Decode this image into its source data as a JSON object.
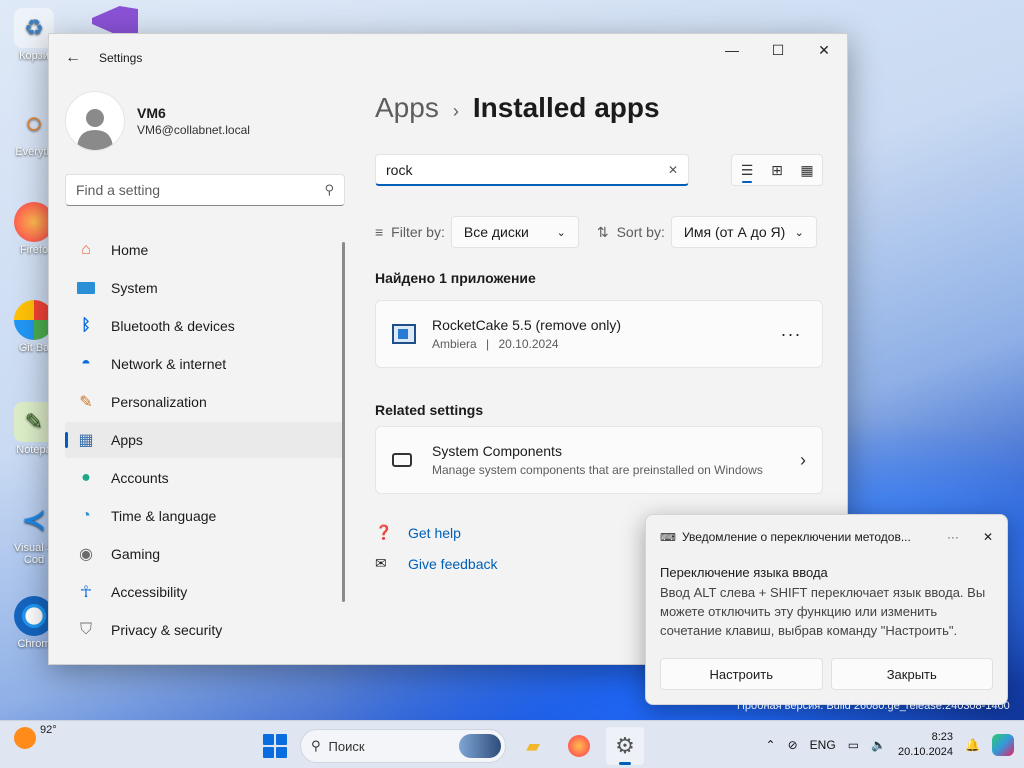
{
  "desktop": {
    "icons": [
      {
        "label": "Корзи",
        "icon": "recycle-bin-icon",
        "color": "#e8eef5"
      },
      {
        "label": "Everyth",
        "icon": "search-magnifier-icon",
        "color": "#f07a1a"
      },
      {
        "label": "Firefo",
        "icon": "firefox-icon",
        "color": "#ff7139"
      },
      {
        "label": "Git Ba",
        "icon": "git-bash-icon",
        "color": "#e8e8e8"
      },
      {
        "label": "Notepa",
        "icon": "notepad-icon",
        "color": "#7cb342"
      },
      {
        "label": "Visual S Cod",
        "icon": "vscode-icon",
        "color": "#1e88e5"
      },
      {
        "label": "Chrom",
        "icon": "chrome-icon",
        "color": "#2196f3"
      }
    ],
    "watermark": "Пробная версия. Build 26080.ge_release.240308-1400"
  },
  "window": {
    "title": "Settings",
    "controls": {
      "minimize": "—",
      "maximize": "☐",
      "close": "✕"
    }
  },
  "profile": {
    "name": "VM6",
    "email": "VM6@collabnet.local"
  },
  "sidebar": {
    "search_placeholder": "Find a setting",
    "items": [
      {
        "label": "Home",
        "icon": "home-icon"
      },
      {
        "label": "System",
        "icon": "system-icon"
      },
      {
        "label": "Bluetooth & devices",
        "icon": "bluetooth-icon"
      },
      {
        "label": "Network & internet",
        "icon": "wifi-icon"
      },
      {
        "label": "Personalization",
        "icon": "brush-icon"
      },
      {
        "label": "Apps",
        "icon": "apps-icon",
        "active": true
      },
      {
        "label": "Accounts",
        "icon": "accounts-icon"
      },
      {
        "label": "Time & language",
        "icon": "globe-clock-icon"
      },
      {
        "label": "Gaming",
        "icon": "gamepad-icon"
      },
      {
        "label": "Accessibility",
        "icon": "accessibility-icon"
      },
      {
        "label": "Privacy & security",
        "icon": "shield-icon"
      }
    ]
  },
  "main": {
    "breadcrumb_parent": "Apps",
    "breadcrumb_current": "Installed apps",
    "search_value": "rock",
    "filter_label": "Filter by:",
    "filter_value": "Все диски",
    "sort_label": "Sort by:",
    "sort_value": "Имя (от А до Я)",
    "found_text": "Найдено 1 приложение",
    "app": {
      "name": "RocketCake 5.5 (remove only)",
      "publisher": "Ambiera",
      "separator": "|",
      "date": "20.10.2024"
    },
    "related_title": "Related settings",
    "related": {
      "title": "System Components",
      "desc": "Manage system components that are preinstalled on Windows"
    },
    "get_help": "Get help",
    "give_feedback": "Give feedback"
  },
  "toast": {
    "header": "Уведомление о переключении методов...",
    "title": "Переключение языка ввода",
    "body": "Ввод ALT слева + SHIFT переключает язык ввода. Вы можете отключить эту функцию или изменить сочетание клавиш, выбрав команду \"Настроить\".",
    "btn_configure": "Настроить",
    "btn_close": "Закрыть"
  },
  "taskbar": {
    "weather_temp": "92°",
    "search_label": "Поиск",
    "lang": "ENG",
    "time": "8:23",
    "date": "20.10.2024"
  },
  "colors": {
    "accent": "#005fb8",
    "window_bg": "#f3f3f3",
    "taskbar_bg": "#dfe6f1"
  }
}
